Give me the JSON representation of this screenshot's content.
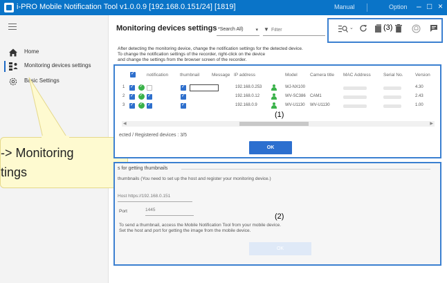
{
  "titlebar": {
    "title": "i-PRO Mobile Notification Tool  v1.0.0.9 [192.168.0.151/24] [1819]",
    "manual": "Manual",
    "option": "Option",
    "minimize": "–",
    "maximize": "□",
    "close": "×"
  },
  "sidebar": {
    "items": [
      {
        "label": "Home",
        "icon": "home-icon"
      },
      {
        "label": "Monitoring devices settings",
        "icon": "devices-icon"
      },
      {
        "label": "Basic Settings",
        "icon": "gear-icon"
      }
    ]
  },
  "callout": {
    "line1": "-> Monitoring",
    "line2": "tings"
  },
  "header": {
    "title": "Monitoring devices settings",
    "search_select": "*Search All)",
    "filter_placeholder": "Filter",
    "toolbar_label": "(3)"
  },
  "instructions": {
    "line1": "After detecting the monitoring device, change the notification settings for the detected device.",
    "line2": "To change the notification settings of the recorder, right-click on the device",
    "line3": "and change the settings from the browser screen of the recorder."
  },
  "table": {
    "headers": [
      "notification",
      "thumbnail",
      "Message",
      "IP address",
      "Model",
      "Camera title",
      "MAC Address",
      "Serial No.",
      "Version"
    ],
    "rows": [
      {
        "num": "1",
        "ip": "192.168.0.253",
        "model": "WJ-NX100",
        "camera_title": "",
        "version": "4.30",
        "notification_on": false
      },
      {
        "num": "2",
        "ip": "192.168.0.12",
        "model": "WV-SC386",
        "camera_title": "CAM1",
        "version": "2.43",
        "notification_on": true
      },
      {
        "num": "3",
        "ip": "192.168.0.9",
        "model": "WV-U1130",
        "camera_title": "WV-U1130",
        "version": "1.00",
        "notification_on": true
      }
    ]
  },
  "panel1": {
    "label": "(1)",
    "registered": "ected / Registered devices : 3/5",
    "ok": "OK"
  },
  "panel2": {
    "section_title": "s for getting thumbnails",
    "thumb_desc": "thumbnails (You need to set up the host and register your monitoring device.)",
    "host": "Host https://192.168.0.151",
    "port_label": "Port",
    "port_value": "1445",
    "label": "(2)",
    "send_line1": "To send a thumbnail, access the Mobile Notification Tool from your mobile device.",
    "send_line2": "Set the host and port for getting the image from the mobile device.",
    "ok": "OK"
  },
  "colors": {
    "titlebar": "#0a74c8",
    "accent": "#2c6fcf",
    "highlight": "#3a7fd0",
    "status_ok": "#3bb24a",
    "callout": "#fefad0"
  }
}
